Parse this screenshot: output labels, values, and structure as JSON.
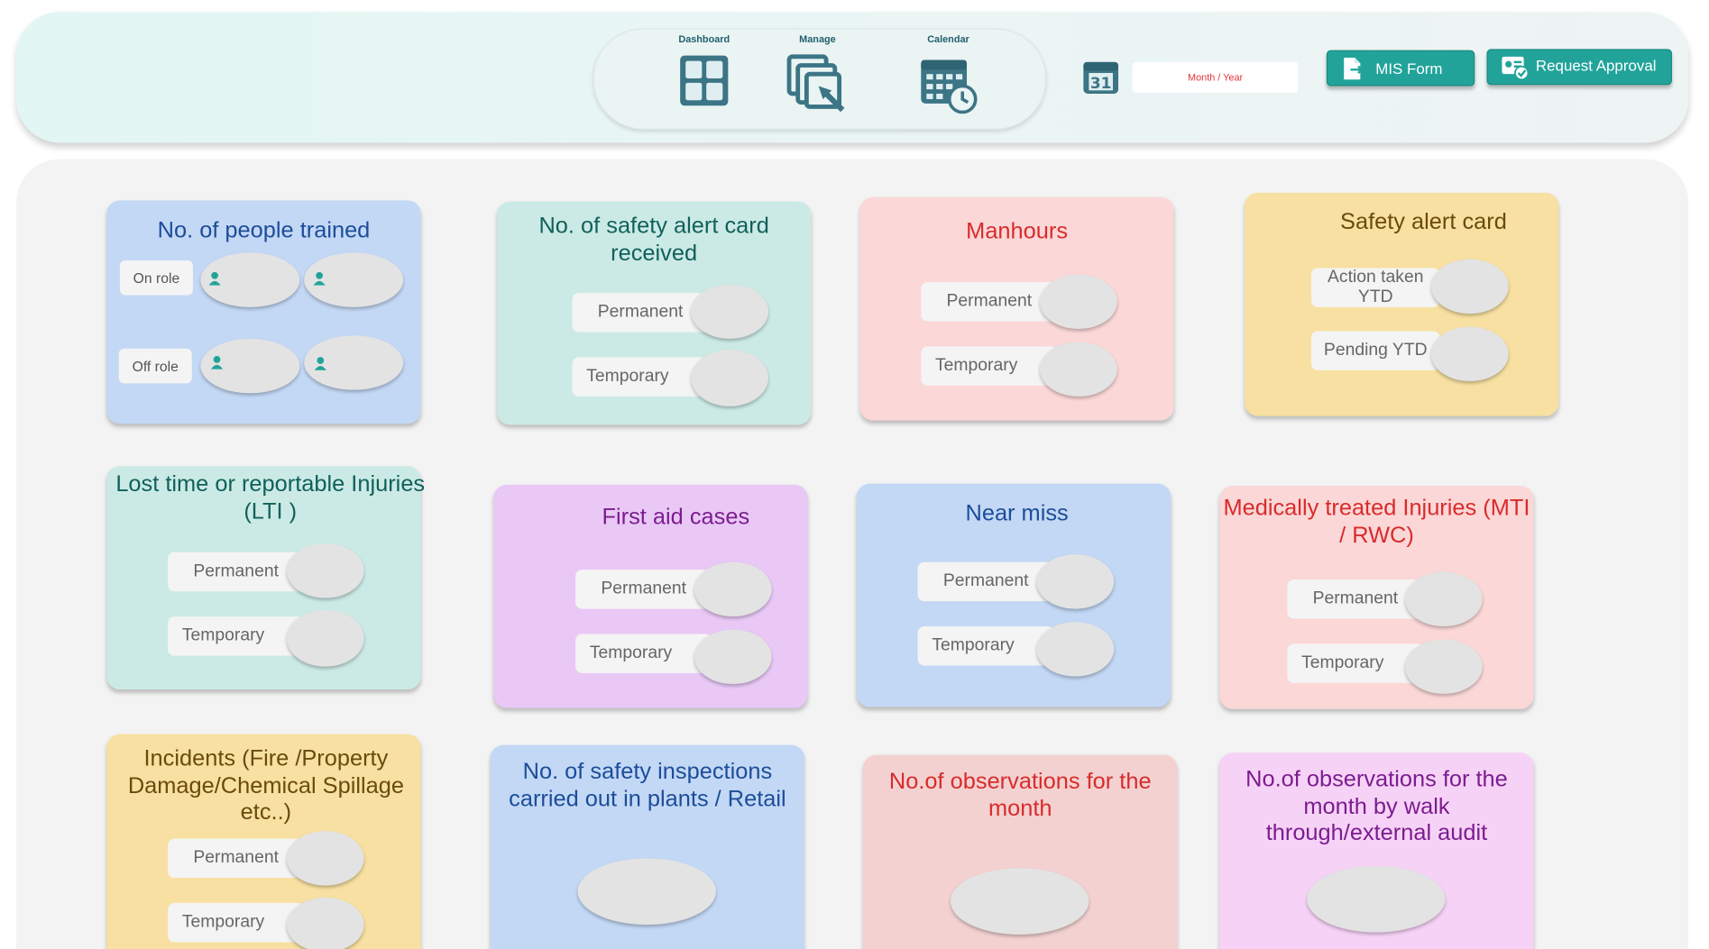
{
  "nav": {
    "items": [
      {
        "label": "Dashboard",
        "icon": "dashboard-grid-icon"
      },
      {
        "label": "Manage",
        "icon": "manage-copy-icon"
      },
      {
        "label": "Calendar",
        "icon": "calendar-clock-icon"
      }
    ],
    "calendar_day": "31",
    "month_year_placeholder": "Month / Year",
    "mis_form_label": "MIS Form",
    "request_approval_label": "Request Approval"
  },
  "colors": {
    "accent": "#22a39a",
    "blue_card": "#c3d8f5",
    "teal_card": "#cbeae6",
    "pink_card": "#fbd7d7",
    "yellow_card": "#f7e0a1",
    "purple_card": "#e9c8f6",
    "magenta_card": "#f7d2f7"
  },
  "cards": {
    "people_trained": {
      "title": "No. of people trained",
      "on_role": "On role",
      "off_role": "Off role"
    },
    "safety_alert_received": {
      "title": "No. of safety alert card received",
      "permanent": "Permanent",
      "temporary": "Temporary"
    },
    "manhours": {
      "title": "Manhours",
      "permanent": "Permanent",
      "temporary": "Temporary"
    },
    "safety_alert_card": {
      "title": "Safety alert card",
      "action_taken": "Action taken YTD",
      "pending": "Pending YTD"
    },
    "lti": {
      "title": "Lost time or reportable Injuries (LTI )",
      "permanent": "Permanent",
      "temporary": "Temporary"
    },
    "first_aid": {
      "title": "First aid cases",
      "permanent": "Permanent",
      "temporary": "Temporary"
    },
    "near_miss": {
      "title": "Near miss",
      "permanent": "Permanent",
      "temporary": "Temporary"
    },
    "mti": {
      "title": "Medically treated Injuries (MTI / RWC)",
      "permanent": "Permanent",
      "temporary": "Temporary"
    },
    "incidents": {
      "title": "Incidents (Fire /Property Damage/Chemical Spillage etc..)",
      "permanent": "Permanent",
      "temporary": "Temporary"
    },
    "inspections": {
      "title": "No. of  safety inspections carried out in plants / Retail"
    },
    "observations": {
      "title": "No.of observations for the month"
    },
    "observations_walk": {
      "title": "No.of observations for the month by walk through/external audit"
    }
  }
}
